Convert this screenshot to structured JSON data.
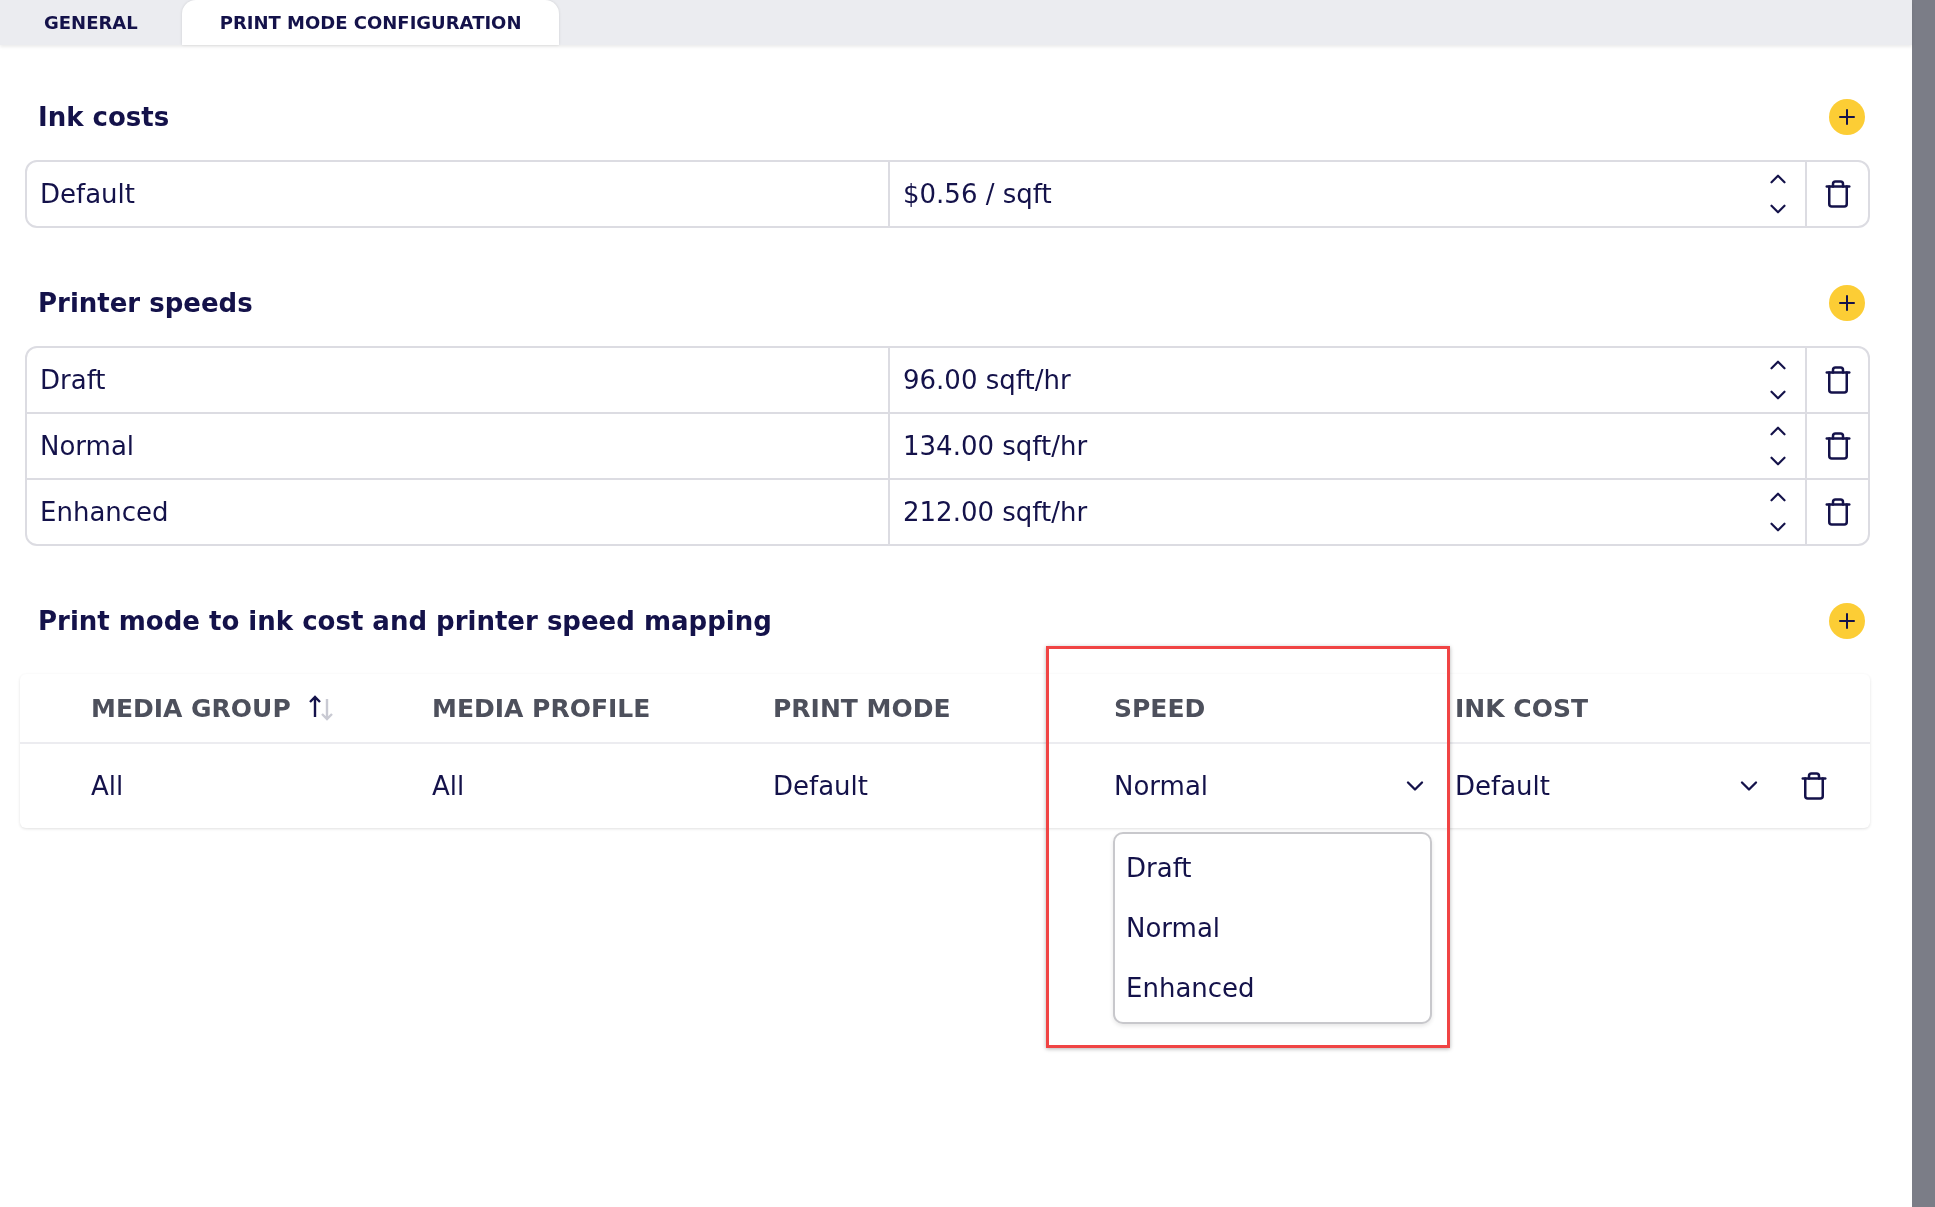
{
  "tabs": [
    {
      "label": "GENERAL",
      "selected": false
    },
    {
      "label": "PRINT MODE CONFIGURATION",
      "selected": true
    }
  ],
  "ink_costs": {
    "title": "Ink costs",
    "rows": [
      {
        "name": "Default",
        "value": "$0.56 / sqft"
      }
    ]
  },
  "printer_speeds": {
    "title": "Printer speeds",
    "rows": [
      {
        "name": "Draft",
        "value": "96.00 sqft/hr"
      },
      {
        "name": "Normal",
        "value": "134.00 sqft/hr"
      },
      {
        "name": "Enhanced",
        "value": "212.00 sqft/hr"
      }
    ]
  },
  "mapping": {
    "title": "Print mode to ink cost and printer speed mapping",
    "columns": [
      {
        "label": "MEDIA GROUP",
        "sorted_ascending": true
      },
      {
        "label": "MEDIA PROFILE"
      },
      {
        "label": "PRINT MODE"
      },
      {
        "label": "SPEED"
      },
      {
        "label": "INK COST"
      }
    ],
    "rows": [
      {
        "media_group": "All",
        "media_profile": "All",
        "print_mode": "Default",
        "speed": "Normal",
        "ink_cost": "Default"
      }
    ],
    "speed_dropdown": {
      "options": [
        "Draft",
        "Normal",
        "Enhanced"
      ]
    }
  }
}
